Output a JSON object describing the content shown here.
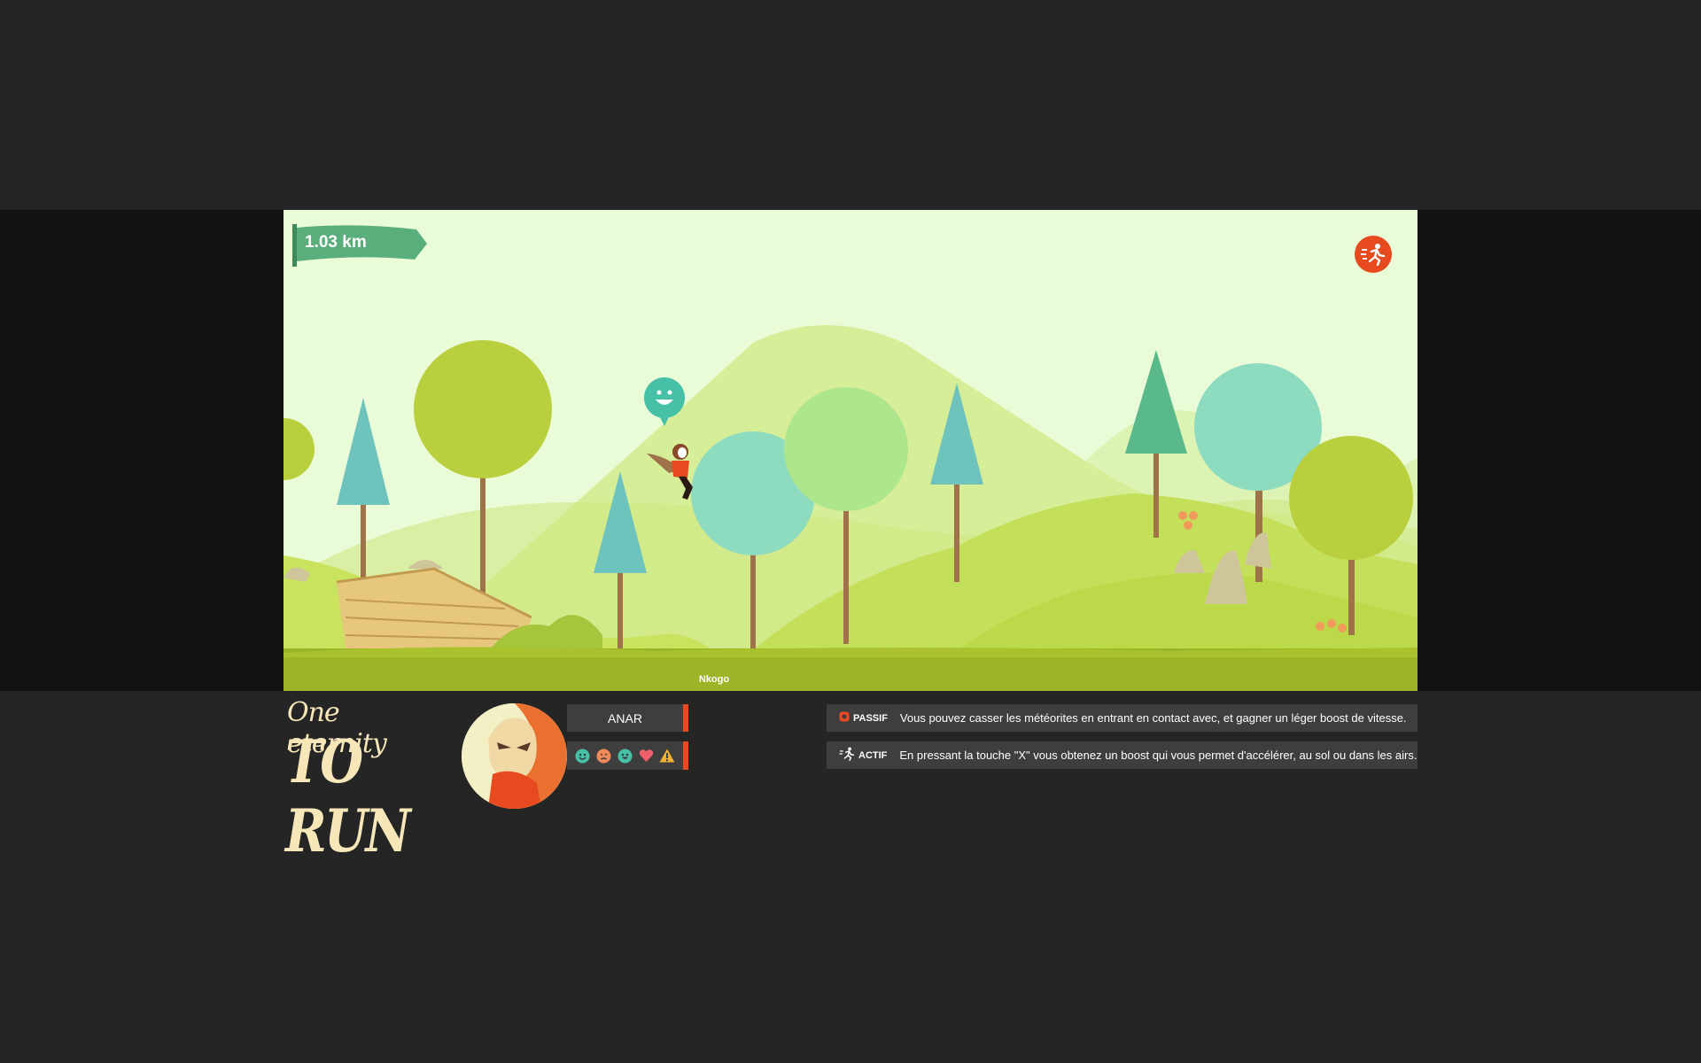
{
  "hud": {
    "distance": "1.03 km",
    "sprint_icon": "running-man-icon",
    "player_name": "Nkogo",
    "mood_icon": "smiley-icon"
  },
  "logo": {
    "line1": "One eternity",
    "line2": "TO RUN"
  },
  "character": {
    "name": "ANAR",
    "avatar_icon": "masked-character-avatar",
    "stat_icons": [
      "happy-face-icon",
      "angry-face-icon",
      "smile-face-icon",
      "heart-icon",
      "warning-icon"
    ]
  },
  "abilities": {
    "passive": {
      "icon": "meteor-icon",
      "kind": "PASSIF",
      "text": "Vous pouvez casser les météorites en entrant en contact avec, et gagner un léger boost de vitesse."
    },
    "active": {
      "icon": "running-man-icon",
      "kind": "ACTIF",
      "text": "En pressant la touche \"X\" vous obtenez un boost qui vous permet d'accélérer, au sol ou dans les airs."
    }
  },
  "colors": {
    "accent": "#e64a1e",
    "flag": "#5aae7c",
    "ground": "#9bb526",
    "panel": "#3e3e3e",
    "logo": "#f6e6b8"
  }
}
